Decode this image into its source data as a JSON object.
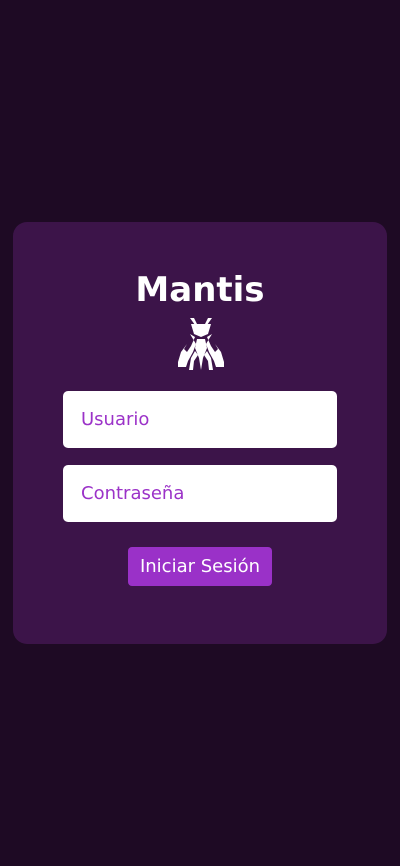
{
  "login": {
    "title": "Mantis",
    "logo_icon": "mantis-icon",
    "username_placeholder": "Usuario",
    "password_placeholder": "Contraseña",
    "submit_label": "Iniciar Sesión"
  },
  "colors": {
    "background": "#1e0a24",
    "card": "#3c1449",
    "accent": "#9a31c8",
    "text": "#ffffff"
  }
}
